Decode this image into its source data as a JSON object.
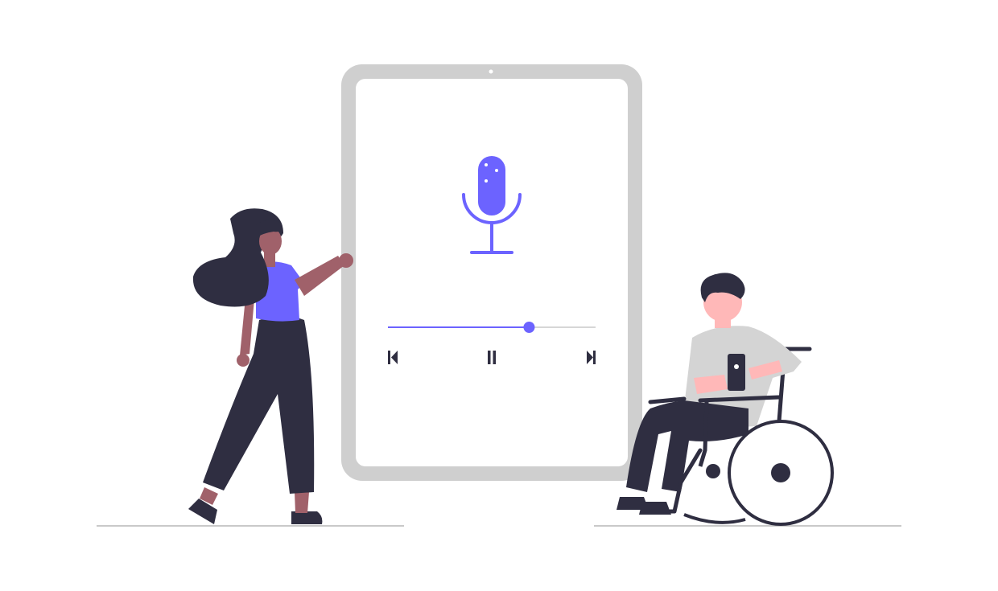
{
  "illustration": {
    "colors": {
      "accent": "#6c63ff",
      "tablet_frame": "#cfcfcf",
      "tablet_screen": "#ffffff",
      "dark": "#2f2e41",
      "skin_dark": "#a0616a",
      "skin_light": "#ffb8b8",
      "shirt_gray": "#d4d4d4",
      "ground": "#c9c9c9",
      "track_rest": "#d6d6d6"
    },
    "tablet": {
      "screen_icon": "microphone-icon"
    },
    "player": {
      "progress": 0.68,
      "controls": [
        "skip-previous-icon",
        "pause-icon",
        "skip-next-icon"
      ],
      "playing": true
    },
    "figures": [
      "standing-woman",
      "man-in-wheelchair"
    ]
  }
}
